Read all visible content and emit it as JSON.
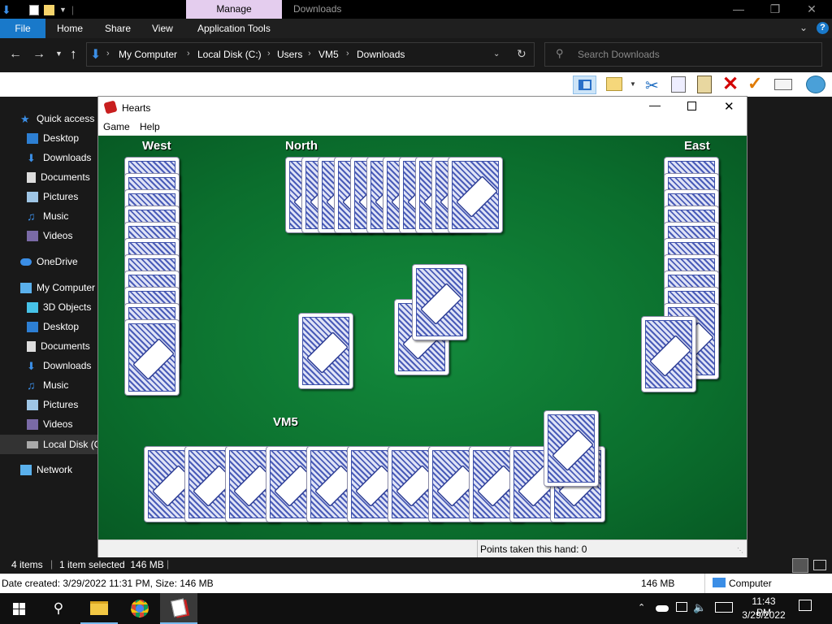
{
  "explorer": {
    "manage_tab": "Manage",
    "window_title": "Downloads",
    "tabs": [
      "File",
      "Home",
      "Share",
      "View",
      "Application Tools"
    ],
    "breadcrumb": [
      "My Computer",
      "Local Disk (C:)",
      "Users",
      "VM5",
      "Downloads"
    ],
    "search_placeholder": "Search Downloads",
    "nav": {
      "quick_access": "Quick access",
      "quick_items": [
        "Desktop",
        "Downloads",
        "Documents",
        "Pictures",
        "Music",
        "Videos"
      ],
      "onedrive": "OneDrive",
      "my_computer": "My Computer",
      "pc_items": [
        "3D Objects",
        "Desktop",
        "Documents",
        "Downloads",
        "Music",
        "Pictures",
        "Videos",
        "Local Disk (C:)"
      ],
      "network": "Network"
    },
    "status": {
      "items": "4 items",
      "selected": "1 item selected  146 MB"
    },
    "details": {
      "created": "Date created: 3/29/2022 11:31 PM, Size: 146 MB",
      "size": "146 MB",
      "location": "Computer"
    }
  },
  "hearts": {
    "title": "Hearts",
    "menu": [
      "Game",
      "Help"
    ],
    "players": {
      "west": "West",
      "north": "North",
      "east": "East",
      "south": "VM5"
    },
    "status_text": "Points taken this hand: 0",
    "hand_counts": {
      "west": 12,
      "north": 12,
      "east": 12,
      "south": 12
    }
  },
  "taskbar": {
    "time": "11:43 PM",
    "date": "3/29/2022"
  },
  "colors": {
    "felt": "#0b6e2d",
    "file_tab": "#1979ca",
    "manage_tab": "#e4cdee"
  }
}
